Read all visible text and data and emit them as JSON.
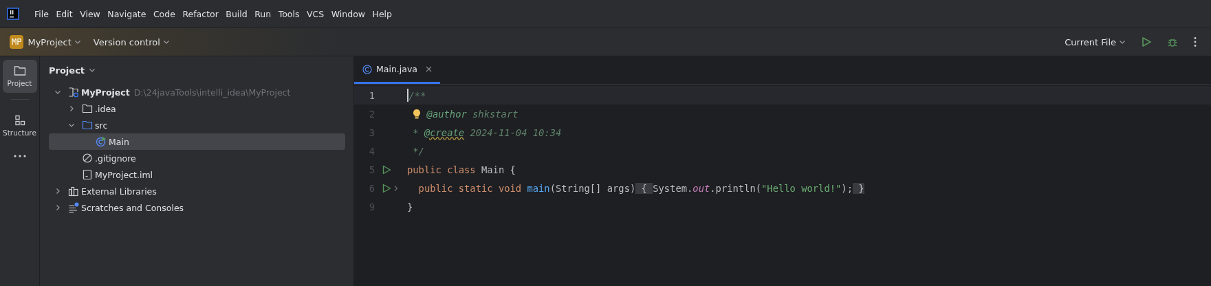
{
  "menu_bar": {
    "items": [
      "File",
      "Edit",
      "View",
      "Navigate",
      "Code",
      "Refactor",
      "Build",
      "Run",
      "Tools",
      "VCS",
      "Window",
      "Help"
    ]
  },
  "toolbar": {
    "project_badge": "MP",
    "project": "MyProject",
    "vcs": "Version control",
    "run_config": "Current File"
  },
  "tool_stripe": [
    {
      "label": "Project",
      "kind": "folder",
      "selected": true
    },
    {
      "label": "Structure",
      "kind": "structure",
      "selected": false
    }
  ],
  "project_panel": {
    "title": "Project",
    "tree": [
      {
        "label": "MyProject",
        "kind": "project",
        "hint": "D:\\24javaTools\\intelli_idea\\MyProject",
        "expanded": true,
        "selected": false,
        "children": [
          {
            "label": ".idea",
            "kind": "folder",
            "expanded": false,
            "selected": false
          },
          {
            "label": "src",
            "kind": "source-folder",
            "expanded": true,
            "selected": false,
            "children": [
              {
                "label": "Main",
                "kind": "class",
                "selected": true
              }
            ]
          },
          {
            "label": ".gitignore",
            "kind": "ignore",
            "selected": false
          },
          {
            "label": "MyProject.iml",
            "kind": "file",
            "selected": false
          }
        ]
      },
      {
        "label": "External Libraries",
        "kind": "libraries",
        "expanded": false,
        "selected": false
      },
      {
        "label": "Scratches and Consoles",
        "kind": "scratches",
        "expanded": false,
        "selected": false
      }
    ]
  },
  "editor": {
    "tabs": [
      {
        "label": "Main.java",
        "selected": true
      }
    ],
    "lines": [
      {
        "number": "1",
        "current": true,
        "tokens": [
          {
            "kind": "comment",
            "text": "/**"
          }
        ]
      },
      {
        "number": "2",
        "current": false,
        "tokens": [
          {
            "kind": "bulb"
          },
          {
            "kind": "doc-tag",
            "text": "@author"
          },
          {
            "kind": "comment",
            "text": " shkstart"
          }
        ]
      },
      {
        "number": "3",
        "current": false,
        "tokens": [
          {
            "kind": "comment",
            "text": " * "
          },
          {
            "kind": "doc-tag",
            "text": "@create",
            "typo": true
          },
          {
            "kind": "comment",
            "text": " 2024-11-04 10:34"
          }
        ]
      },
      {
        "number": "4",
        "current": false,
        "tokens": [
          {
            "kind": "comment",
            "text": " */"
          }
        ]
      },
      {
        "number": "5",
        "current": false,
        "run": true,
        "tokens": [
          {
            "kind": "keyword",
            "text": "public class "
          },
          {
            "kind": "plain",
            "text": "Main {"
          }
        ]
      },
      {
        "number": "6",
        "current": false,
        "run": true,
        "foldable": true,
        "tokens": [
          {
            "kind": "keyword",
            "text": "  public static void "
          },
          {
            "kind": "method",
            "text": "main"
          },
          {
            "kind": "plain",
            "text": "(String[] args)"
          },
          {
            "kind": "fold",
            "text": " { "
          },
          {
            "kind": "plain",
            "text": "System."
          },
          {
            "kind": "static-field",
            "text": "out"
          },
          {
            "kind": "plain",
            "text": ".println("
          },
          {
            "kind": "string",
            "text": "\"Hello world!\""
          },
          {
            "kind": "plain",
            "text": ");"
          },
          {
            "kind": "fold",
            "text": " }"
          }
        ]
      },
      {
        "number": "9",
        "current": false,
        "tokens": [
          {
            "kind": "plain",
            "text": "}"
          }
        ]
      }
    ]
  }
}
